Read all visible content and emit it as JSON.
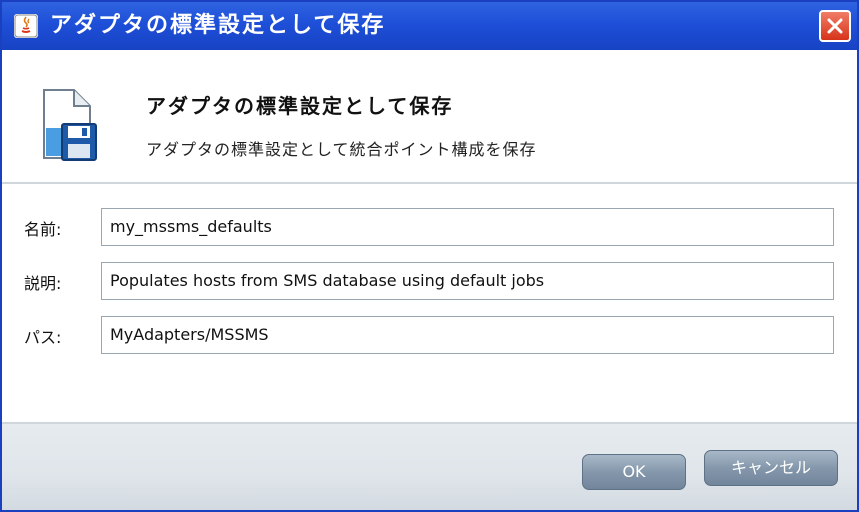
{
  "window": {
    "title": "アダプタの標準設定として保存",
    "close_icon": "close-icon",
    "app_icon": "java-icon"
  },
  "header": {
    "icon": "save-document-icon",
    "title": "アダプタの標準設定として保存",
    "description": "アダプタの標準設定として統合ポイント構成を保存"
  },
  "form": {
    "name_label": "名前:",
    "name_value": "my_mssms_defaults",
    "description_label": "説明:",
    "description_value": "Populates hosts from SMS database using default jobs",
    "path_label": "パス:",
    "path_value": "MyAdapters/MSSMS"
  },
  "buttons": {
    "ok": "OK",
    "cancel": "キャンセル"
  },
  "colors": {
    "titlebar": "#1e4fd8",
    "close_button": "#d7331b",
    "button": "#8497ab",
    "footer": "#dfe5ea"
  }
}
